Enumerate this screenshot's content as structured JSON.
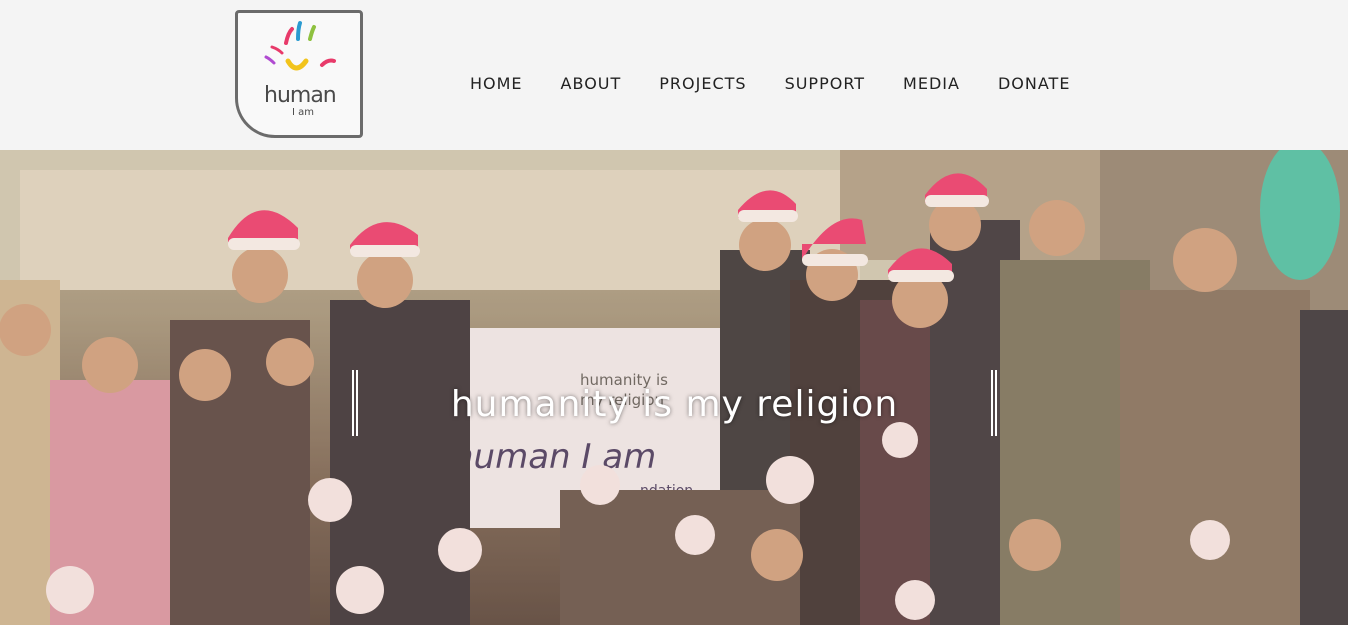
{
  "logo": {
    "word1": "human",
    "word2": "I am"
  },
  "nav": {
    "items": [
      "HOME",
      "ABOUT",
      "PROJECTS",
      "SUPPORT",
      "MEDIA",
      "DONATE"
    ]
  },
  "hero": {
    "tagline": "humanity is my religion",
    "banner_text1": "humanity is",
    "banner_text2": "my religion",
    "banner_big": "human I am",
    "banner_small": "ndation"
  },
  "colors": {
    "header_bg": "#f4f4f4",
    "nav_text": "#222222",
    "tagline": "#ffffff"
  }
}
